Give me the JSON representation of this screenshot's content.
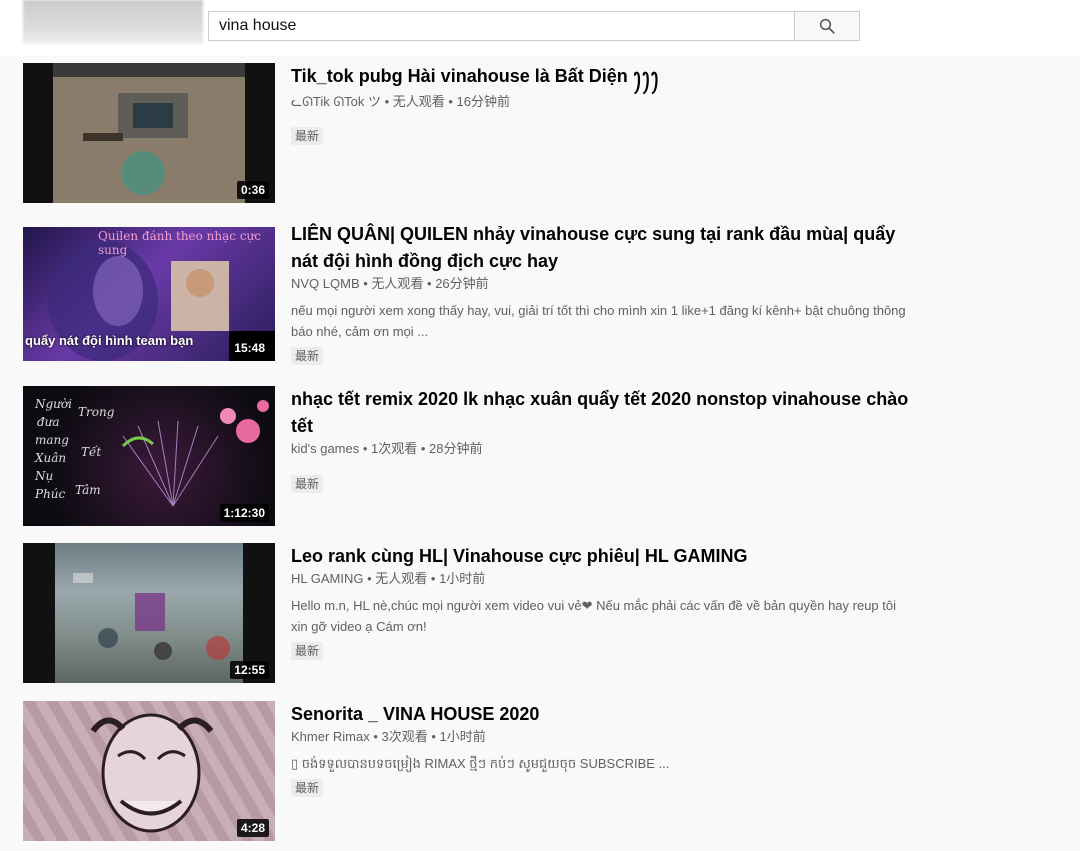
{
  "search": {
    "query": "vina house",
    "placeholder": ""
  },
  "results": [
    {
      "title": "Tik_tok pubg Hài vinahouse là Bất Diện ꫂꫂꫂ",
      "channel": "ᓚᘏTik ᘏTok ツ",
      "views": "无人观看",
      "time": "16分钟前",
      "description": "",
      "badge": "最新",
      "duration": "0:36"
    },
    {
      "title": "LIÊN QUÂN| QUILEN nhảy vinahouse cực sung tại rank đầu mùa| quẩy nát đội hình đồng địch cực hay",
      "channel": "NVQ LQMB",
      "views": "无人观看",
      "time": "26分钟前",
      "description": "nếu mọi người xem xong thấy hay, vui, giải trí tốt thì cho mình xin 1 like+1 đăng kí kênh+ bật chuông thông báo nhé, cảm ơn mọi ...",
      "badge": "最新",
      "duration": "15:48",
      "thumb_text_top": "Quilen đánh theo nhạc cực sung",
      "thumb_text_bottom": "quẩy nát đội hình team bạn"
    },
    {
      "title": "nhạc tết remix 2020 lk nhạc xuân quẩy tết 2020 nonstop vinahouse chào tết",
      "channel": "kid's games",
      "views": "1次观看",
      "time": "28分钟前",
      "description": "",
      "badge": "最新",
      "duration": "1:12:30"
    },
    {
      "title": "Leo rank cùng HL| Vinahouse cực phiêu| HL GAMING",
      "channel": "HL GAMING",
      "views": "无人观看",
      "time": "1小时前",
      "description": "Hello m.n, HL nè,chúc mọi người xem video vui vẻ❤ Nếu mắc phải các vấn đề về bản quyền hay reup tôi xin gỡ video ạ Cám ơn!",
      "badge": "最新",
      "duration": "12:55"
    },
    {
      "title": "Senorita _ VINA HOUSE 2020",
      "channel": "Khmer Rimax",
      "views": "3次观看",
      "time": "1小时前",
      "description": "▯ ចង់ទទួលបានបទចម្រៀង RIMAX ថ្មីៗ កប់ៗ សូមជួយចុច SUBSCRIBE ...",
      "badge": "最新",
      "duration": "4:28"
    }
  ],
  "separator": " • ",
  "colors": {
    "title": "#030303",
    "meta": "#606060",
    "badge_bg": "#ececec",
    "background": "#f9f9f9"
  },
  "icons": {
    "search": "search-icon"
  }
}
